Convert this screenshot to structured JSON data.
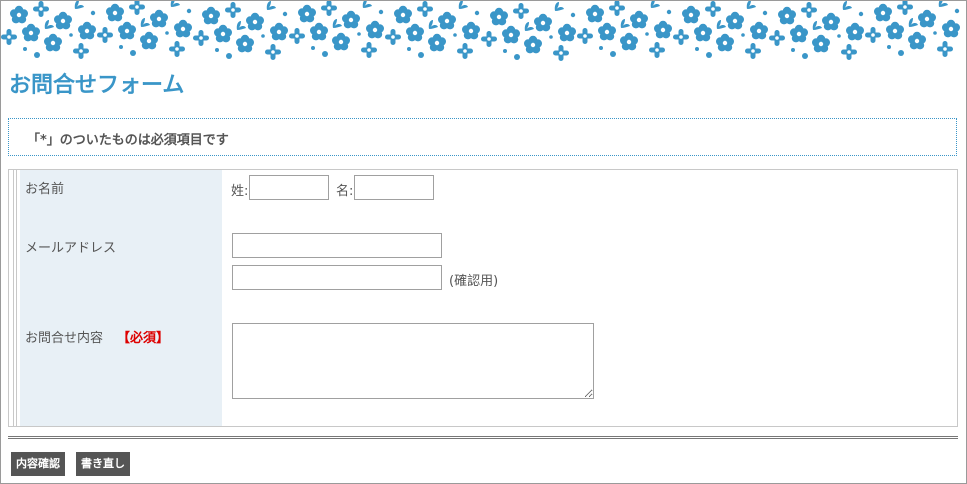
{
  "page": {
    "title": "お問合せフォーム",
    "notice": "「*」のついたものは必須項目です"
  },
  "colors": {
    "accent": "#3a96c8",
    "label_bg": "#e8f0f6",
    "required": "#dd0000",
    "button_bg": "#555555"
  },
  "form": {
    "name": {
      "label": "お名前",
      "last_name_label": "姓:",
      "first_name_label": "名:",
      "last_name_value": "",
      "first_name_value": ""
    },
    "email": {
      "label": "メールアドレス",
      "value": "",
      "confirm_value": "",
      "confirm_note": "(確認用)"
    },
    "inquiry": {
      "label": "お問合せ内容",
      "required_mark": "【必須】",
      "value": ""
    }
  },
  "buttons": {
    "confirm": "内容確認",
    "reset": "書き直し"
  }
}
